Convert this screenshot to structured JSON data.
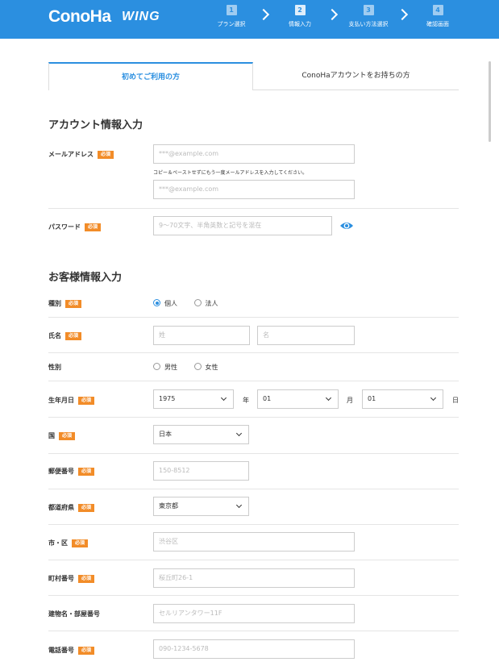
{
  "header": {
    "logo": "ConoHa",
    "logo_suffix": "WING",
    "steps": [
      {
        "num": "1",
        "label": "プラン選択"
      },
      {
        "num": "2",
        "label": "情報入力"
      },
      {
        "num": "3",
        "label": "支払い方法選択"
      },
      {
        "num": "4",
        "label": "確認画面"
      }
    ]
  },
  "tabs": {
    "new_user": "初めてご利用の方",
    "existing_user": "ConoHaアカウントをお持ちの方"
  },
  "account_section": {
    "title": "アカウント情報入力",
    "email_label": "メールアドレス",
    "email_placeholder": "***@example.com",
    "email_hint": "コピー＆ペーストせずにもう一度メールアドレスを入力してください。",
    "email_confirm_placeholder": "***@example.com",
    "password_label": "パスワード",
    "password_placeholder": "9～70文字、半角英数と記号を混在"
  },
  "customer_section": {
    "title": "お客様情報入力",
    "type_label": "種別",
    "type_options": [
      "個人",
      "法人"
    ],
    "name_label": "氏名",
    "last_name_placeholder": "姓",
    "first_name_placeholder": "名",
    "gender_label": "性別",
    "gender_options": [
      "男性",
      "女性"
    ],
    "birthdate_label": "生年月日",
    "birth_year": "1975",
    "year_unit": "年",
    "birth_month": "01",
    "month_unit": "月",
    "birth_day": "01",
    "day_unit": "日",
    "country_label": "国",
    "country_value": "日本",
    "postal_label": "郵便番号",
    "postal_placeholder": "150-8512",
    "prefecture_label": "都道府県",
    "prefecture_value": "東京都",
    "city_label": "市・区",
    "city_placeholder": "渋谷区",
    "town_label": "町村番号",
    "town_placeholder": "桜丘町26-1",
    "building_label": "建物名・部屋番号",
    "building_placeholder": "セルリアンタワー11F",
    "phone_label": "電話番号",
    "phone_placeholder": "090-1234-5678"
  },
  "required_badge": "必須",
  "colors": {
    "brand": "#2b8fe0",
    "required": "#f28c28"
  }
}
